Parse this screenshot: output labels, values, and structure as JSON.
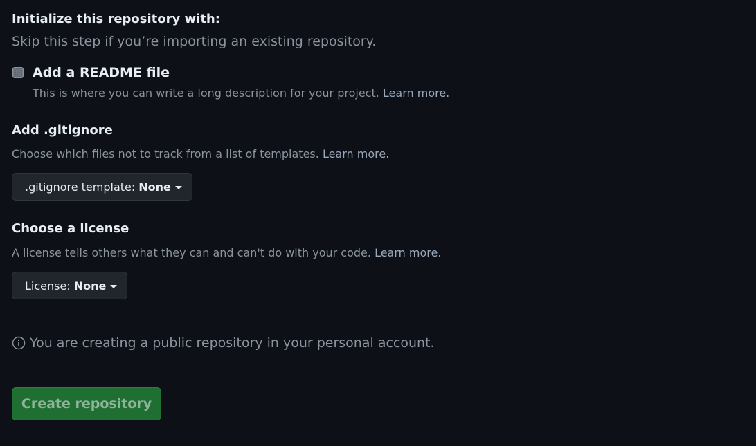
{
  "init": {
    "title": "Initialize this repository with:",
    "subtitle": "Skip this step if you’re importing an existing repository."
  },
  "readme": {
    "label": "Add a README file",
    "description": "This is where you can write a long description for your project.",
    "link": "Learn more.",
    "checked": false
  },
  "gitignore": {
    "title": "Add .gitignore",
    "description": "Choose which files not to track from a list of templates.",
    "link": "Learn more.",
    "select_label": ".gitignore template:",
    "select_value": "None"
  },
  "license": {
    "title": "Choose a license",
    "description": "A license tells others what they can and can't do with your code.",
    "link": "Learn more.",
    "select_label": "License:",
    "select_value": "None"
  },
  "notice": {
    "icon": "info-icon",
    "text": "You are creating a public repository in your personal account."
  },
  "actions": {
    "create_label": "Create repository"
  },
  "colors": {
    "background": "#0d1117",
    "primary_button": "#1f6f33",
    "muted_text": "#8b949e",
    "text": "#e6edf3"
  }
}
